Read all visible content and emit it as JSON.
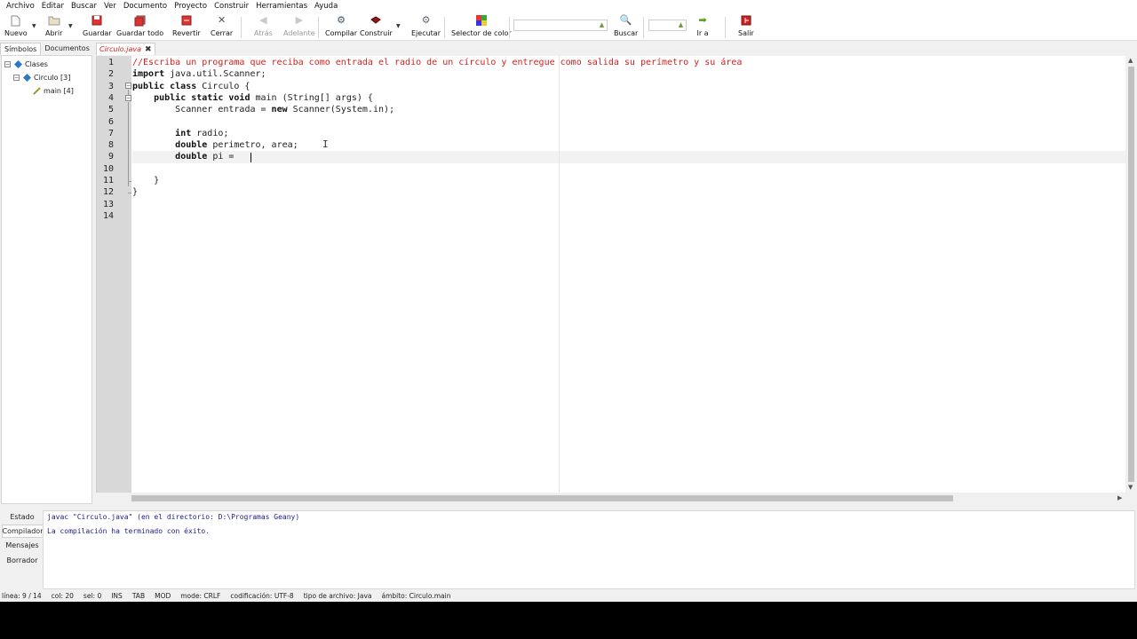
{
  "menu": [
    "Archivo",
    "Editar",
    "Buscar",
    "Ver",
    "Documento",
    "Proyecto",
    "Construir",
    "Herramientas",
    "Ayuda"
  ],
  "toolbar": {
    "nuevo": "Nuevo",
    "abrir": "Abrir",
    "guardar": "Guardar",
    "guardar_todo": "Guardar todo",
    "revertir": "Revertir",
    "cerrar": "Cerrar",
    "atras": "Atrás",
    "adelante": "Adelante",
    "compilar": "Compilar",
    "construir": "Construir",
    "ejecutar": "Ejecutar",
    "selector_color": "Selector de color",
    "buscar": "Buscar",
    "ira": "Ir a",
    "salir": "Salir",
    "search_value": "",
    "line_value": ""
  },
  "sidebar": {
    "tabs": [
      "Símbolos",
      "Documentos"
    ],
    "tree": {
      "root": "Clases",
      "class": "Circulo [3]",
      "method": "main [4]"
    }
  },
  "editor": {
    "tab_label": "Circulo.java",
    "line_numbers": [
      "1",
      "2",
      "3",
      "4",
      "5",
      "6",
      "7",
      "8",
      "9",
      "10",
      "11",
      "12",
      "13",
      "14"
    ],
    "lines": {
      "l1": "//Escriba un programa que reciba como entrada el radio de un círculo y entregue como salida su perímetro y su área",
      "l2_kw": "import",
      "l2_rest": " java.util.Scanner;",
      "l3_kw": "public class",
      "l3_rest": " Circulo {",
      "l4_indent": "    ",
      "l4_kw": "public static void",
      "l4_rest": " main (String[] args) {",
      "l5_indent": "        ",
      "l5_a": "Scanner entrada = ",
      "l5_kw": "new",
      "l5_b": " Scanner(System.in);",
      "l7_indent": "        ",
      "l7_kw": "int",
      "l7_rest": " radio;",
      "l8_indent": "        ",
      "l8_kw": "double",
      "l8_rest": " perimetro, area;",
      "l9_indent": "        ",
      "l9_kw": "double",
      "l9_rest": " pi = ",
      "l11": "    }",
      "l12": "}"
    }
  },
  "messages": {
    "tabs": [
      "Estado",
      "Compilador",
      "Mensajes",
      "Borrador"
    ],
    "compiler_lines": [
      "javac \"Circulo.java\" (en el directorio: D:\\Programas Geany)",
      "La compilación ha terminado con éxito."
    ]
  },
  "status": {
    "linea": "línea: 9 / 14",
    "col": "col: 20",
    "sel": "sel: 0",
    "ins": "INS",
    "tab": "TAB",
    "mod": "MOD",
    "mode": "mode: CRLF",
    "encoding": "codificación: UTF-8",
    "filetype": "tipo de archivo: Java",
    "scope": "ámbito: Circulo.main"
  },
  "colors": {
    "comment": "#d41f1f",
    "tab_label": "#d21f1f",
    "compiler_text": "#1a1a8c",
    "gutter": "#d8d8d8"
  }
}
